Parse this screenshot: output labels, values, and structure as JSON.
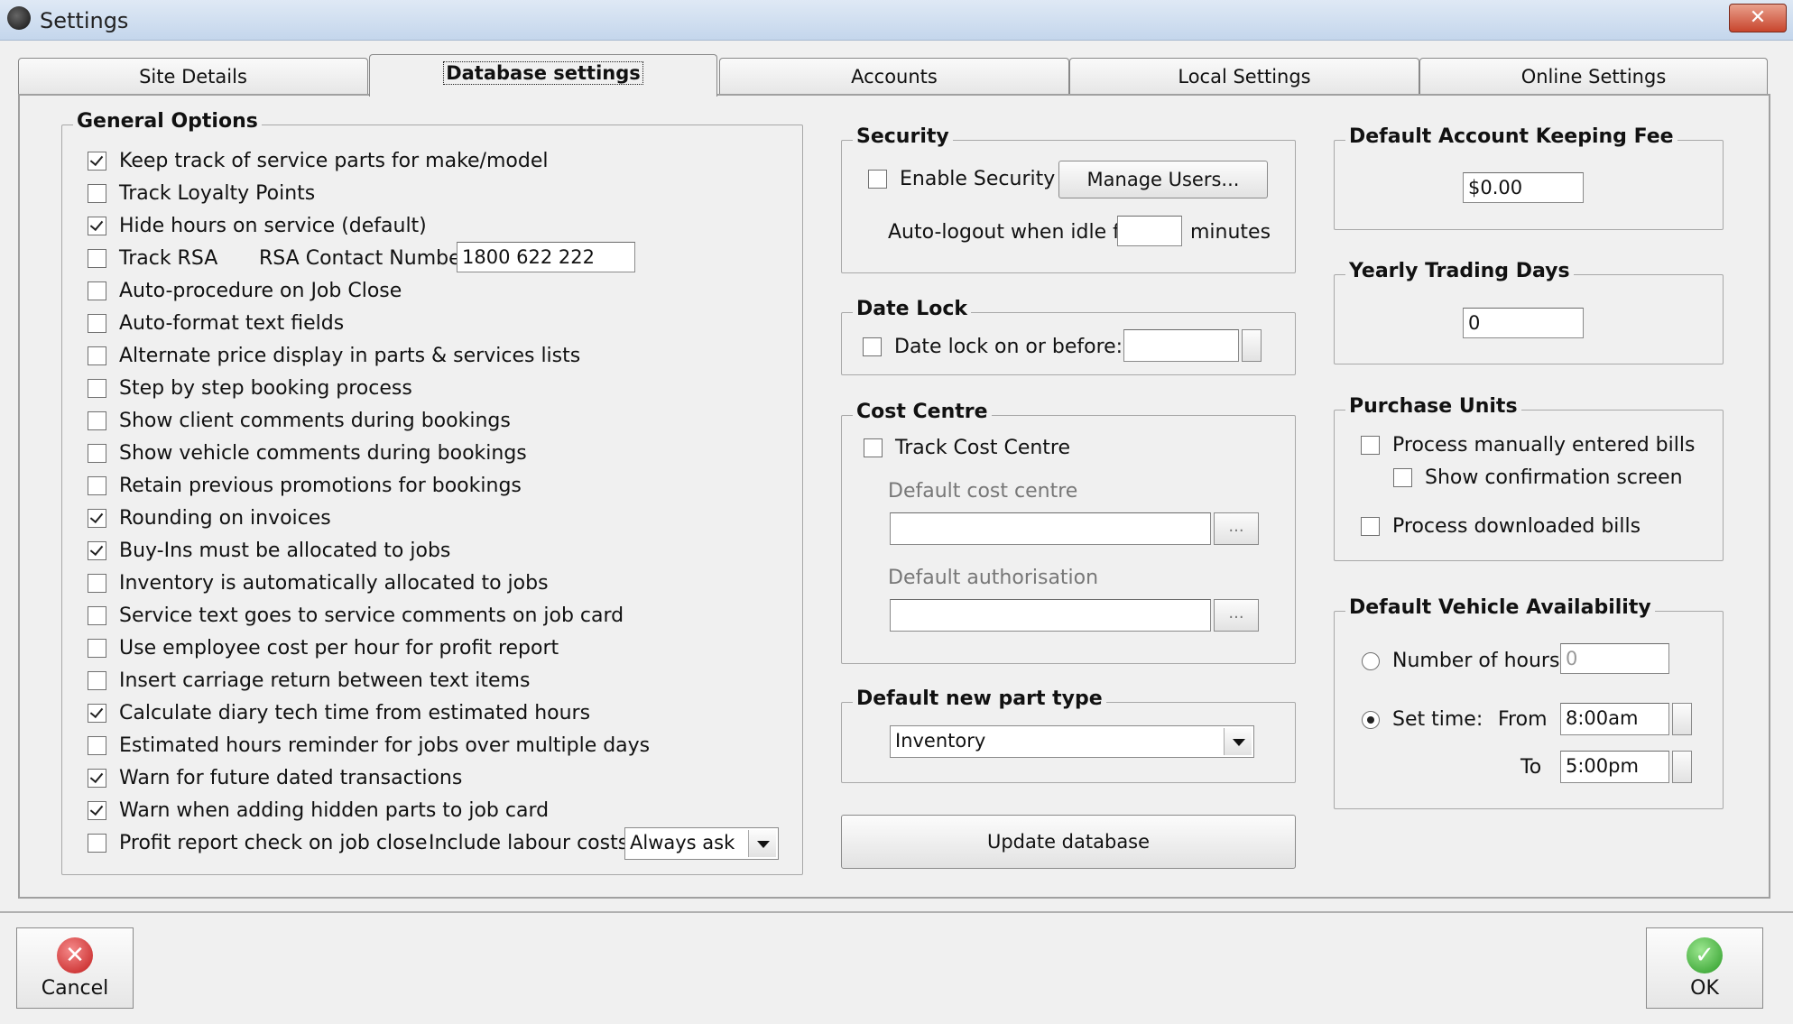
{
  "window": {
    "title": "Settings",
    "close_glyph": "✕"
  },
  "tabs": [
    "Site Details",
    "Database settings",
    "Accounts",
    "Local Settings",
    "Online Settings"
  ],
  "general_options": {
    "title": "General Options",
    "items": [
      {
        "label": "Keep track of service parts for make/model",
        "checked": true
      },
      {
        "label": "Track Loyalty Points",
        "checked": false
      },
      {
        "label": "Hide hours on service (default)",
        "checked": true
      },
      {
        "label": "Track RSA",
        "checked": false
      },
      {
        "label": "Auto-procedure on Job Close",
        "checked": false
      },
      {
        "label": "Auto-format text fields",
        "checked": false
      },
      {
        "label": "Alternate price display in parts & services lists",
        "checked": false
      },
      {
        "label": "Step by step booking process",
        "checked": false
      },
      {
        "label": "Show client comments during bookings",
        "checked": false
      },
      {
        "label": "Show vehicle comments during bookings",
        "checked": false
      },
      {
        "label": "Retain previous promotions for bookings",
        "checked": false
      },
      {
        "label": "Rounding on invoices",
        "checked": true
      },
      {
        "label": "Buy-Ins must be allocated to jobs",
        "checked": true
      },
      {
        "label": "Inventory is automatically allocated to jobs",
        "checked": false
      },
      {
        "label": "Service text goes to service comments on job card",
        "checked": false
      },
      {
        "label": "Use employee cost per hour for profit report",
        "checked": false
      },
      {
        "label": "Insert carriage return between text items",
        "checked": false
      },
      {
        "label": "Calculate diary tech time from estimated hours",
        "checked": true
      },
      {
        "label": "Estimated hours reminder for jobs over multiple days",
        "checked": false
      },
      {
        "label": "Warn for future dated transactions",
        "checked": true
      },
      {
        "label": "Warn when adding hidden parts to job card",
        "checked": true
      },
      {
        "label": "Profit report check on job close",
        "checked": false
      }
    ],
    "rsa_contact_label": "RSA Contact Number",
    "rsa_contact_value": "1800 622 222",
    "labour_costs_label": "Include labour costs?",
    "labour_costs_value": "Always ask"
  },
  "security": {
    "title": "Security",
    "enable_label": "Enable Security",
    "manage_users_label": "Manage Users...",
    "autologout_label": "Auto-logout when idle for",
    "autologout_value": "",
    "minutes_label": "minutes"
  },
  "date_lock": {
    "title": "Date Lock",
    "label": "Date lock on or before:",
    "value": ""
  },
  "cost_centre": {
    "title": "Cost Centre",
    "track_label": "Track Cost Centre",
    "default_cc_label": "Default cost centre",
    "default_cc_value": "",
    "default_auth_label": "Default authorisation",
    "default_auth_value": "",
    "ellipsis": "..."
  },
  "part_type": {
    "title": "Default new part type",
    "value": "Inventory"
  },
  "update_db_label": "Update database",
  "account_fee": {
    "title": "Default Account Keeping Fee",
    "value": "$0.00"
  },
  "trading_days": {
    "title": "Yearly Trading Days",
    "value": "0"
  },
  "purchase_units": {
    "title": "Purchase Units",
    "manual_label": "Process manually entered bills",
    "confirm_label": "Show confirmation screen",
    "downloaded_label": "Process downloaded bills"
  },
  "vehicle_availability": {
    "title": "Default Vehicle Availability",
    "hours_label": "Number of hours:",
    "hours_value": "0",
    "set_time_label": "Set time:",
    "from_label": "From",
    "from_value": "8:00am",
    "to_label": "To",
    "to_value": "5:00pm"
  },
  "footer": {
    "cancel_label": "Cancel",
    "cancel_glyph": "✕",
    "ok_label": "OK",
    "ok_glyph": "✓"
  }
}
